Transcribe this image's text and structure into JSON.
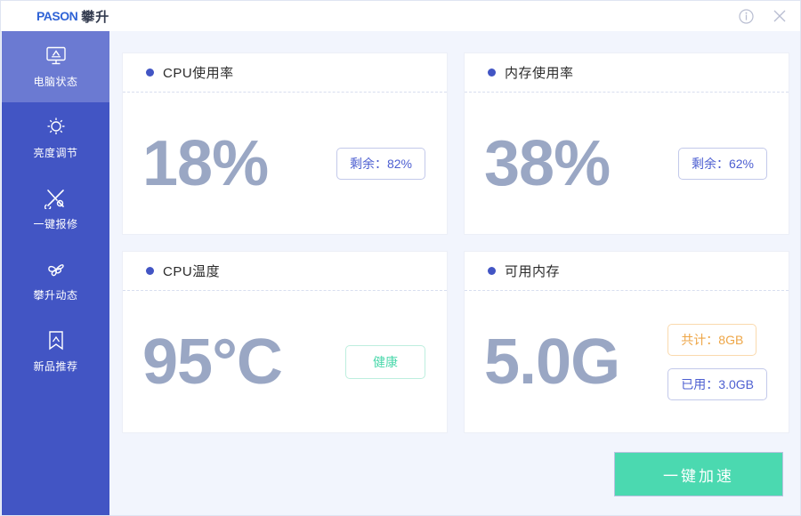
{
  "window": {
    "logo_mark": "PASON",
    "logo_text": "攀升",
    "info_icon": "info-circle-icon",
    "close_icon": "close-icon"
  },
  "sidebar": {
    "items": [
      {
        "label": "电脑状态",
        "icon": "monitor-icon",
        "active": true
      },
      {
        "label": "亮度调节",
        "icon": "brightness-bulb-icon",
        "active": false
      },
      {
        "label": "一键报修",
        "icon": "tools-wrench-icon",
        "active": false
      },
      {
        "label": "攀升动态",
        "icon": "pinwheel-icon",
        "active": false
      },
      {
        "label": "新品推荐",
        "icon": "bookmark-icon",
        "active": false
      }
    ]
  },
  "cards": [
    {
      "title": "CPU使用率",
      "metric": "18%",
      "badges": [
        {
          "text": "剩余：82%",
          "style": "indigo"
        }
      ]
    },
    {
      "title": "内存使用率",
      "metric": "38%",
      "badges": [
        {
          "text": "剩余：62%",
          "style": "indigo"
        }
      ]
    },
    {
      "title": "CPU温度",
      "metric": "95°C",
      "badges": [
        {
          "text": "健康",
          "style": "green"
        }
      ]
    },
    {
      "title": "可用内存",
      "metric": "5.0G",
      "badges": [
        {
          "text": "共计：8GB",
          "style": "orange"
        },
        {
          "text": "已用：3.0GB",
          "style": "indigo"
        }
      ]
    }
  ],
  "actions": {
    "accelerate_label": "一键加速"
  },
  "colors": {
    "sidebar": "#4255c4",
    "sidebar_active": "#6b7ad2",
    "accent_green": "#4bd9b0",
    "metric": "#9aa7c4",
    "badge_indigo": "#4d5fd1",
    "badge_orange": "#eea647",
    "content_bg": "#f2f5fd"
  }
}
